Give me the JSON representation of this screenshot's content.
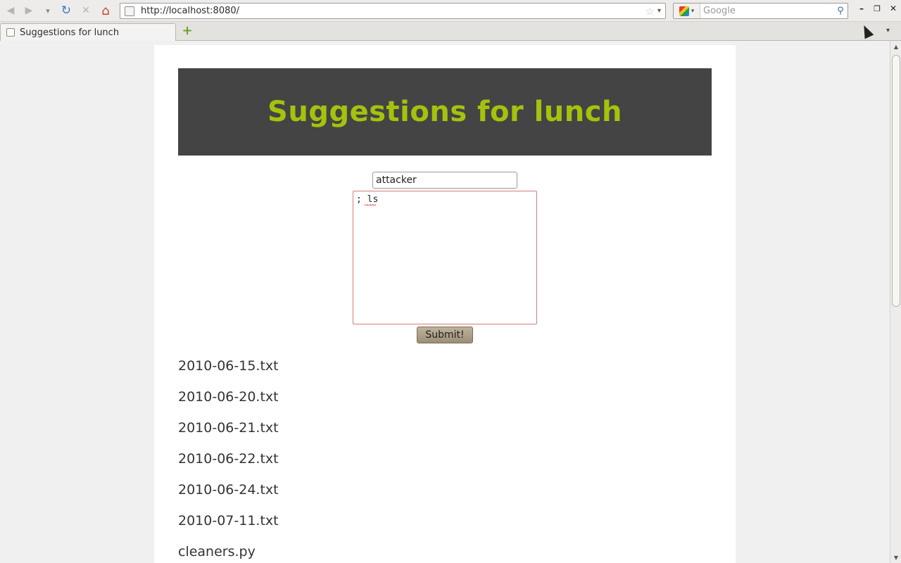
{
  "browser": {
    "url": "http://localhost:8080/",
    "search_placeholder": "Google",
    "tab_title": "Suggestions for lunch",
    "nav_icons": {
      "back": "back-arrow-icon",
      "forward": "forward-arrow-icon",
      "history": "history-dropdown-icon",
      "reload": "reload-icon",
      "stop": "stop-icon",
      "home": "home-icon"
    },
    "glyphs": {
      "back": "◀",
      "forward": "▶",
      "history": "▾",
      "reload": "↻",
      "stop": "✕",
      "home": "⌂",
      "star": "☆",
      "dropdown": "▾",
      "magnifier": "⚲",
      "minimize": "–",
      "maximize": "❐",
      "close": "✕",
      "new_tab": "+",
      "tab_list": "▾",
      "scroll_up": "▲",
      "scroll_down": "▼"
    }
  },
  "page": {
    "title": "Suggestions for lunch",
    "title_color": "#a5c20c",
    "banner_color": "#444444",
    "name_value": "attacker",
    "suggestion_value": "; ls",
    "submit_label": "Submit!",
    "files": [
      "2010-06-15.txt",
      "2010-06-20.txt",
      "2010-06-21.txt",
      "2010-06-22.txt",
      "2010-06-24.txt",
      "2010-07-11.txt",
      "cleaners.py"
    ]
  }
}
